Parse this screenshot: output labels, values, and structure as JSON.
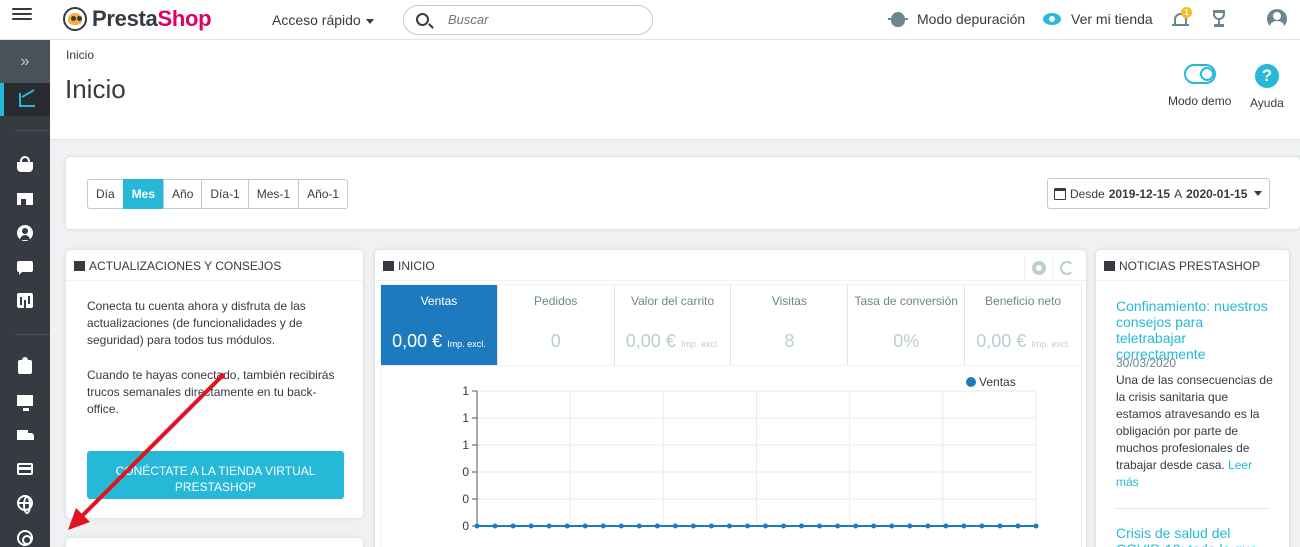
{
  "topbar": {
    "logo_part1": "Presta",
    "logo_part2": "Shop",
    "quick_access": "Acceso rápido",
    "search_placeholder": "Buscar",
    "debug_mode": "Modo depuración",
    "view_store": "Ver mi tienda",
    "notification_count": "1"
  },
  "page": {
    "breadcrumb": "Inicio",
    "title": "Inicio",
    "demo_mode": "Modo demo",
    "help": "Ayuda"
  },
  "filters": {
    "buttons": [
      "Día",
      "Mes",
      "Año",
      "Día-1",
      "Mes-1",
      "Año-1"
    ],
    "active": "Mes",
    "date_from_label": "Desde",
    "date_from": "2019-12-15",
    "date_to_label": "A",
    "date_to": "2020-01-15"
  },
  "updates": {
    "title": "Actualizaciones y consejos",
    "text1": "Conecta tu cuenta ahora y disfruta de las actualizaciones (de funcionalidades y de seguridad) para todos tus módulos.",
    "text2": "Cuando te hayas conectado, también recibirás trucos semanales directamente en tu back-office.",
    "button": "Conéctate a la tienda virtual PrestaShop"
  },
  "dashboard": {
    "title": "Inicio",
    "kpis": [
      {
        "label": "Ventas",
        "value": "0,00 €",
        "suffix": "Imp. excl."
      },
      {
        "label": "Pedidos",
        "value": "0",
        "suffix": ""
      },
      {
        "label": "Valor del carrito",
        "value": "0,00 €",
        "suffix": "Imp. excl."
      },
      {
        "label": "Visitas",
        "value": "8",
        "suffix": ""
      },
      {
        "label": "Tasa de conversión",
        "value": "0%",
        "suffix": ""
      },
      {
        "label": "Beneficio neto",
        "value": "0,00 €",
        "suffix": "Imp. excl."
      }
    ]
  },
  "chart_data": {
    "type": "line",
    "title": "",
    "series": [
      {
        "name": "Ventas",
        "values": [
          0,
          0,
          0,
          0,
          0,
          0,
          0,
          0,
          0,
          0,
          0,
          0,
          0,
          0,
          0,
          0,
          0,
          0,
          0,
          0,
          0,
          0,
          0,
          0,
          0,
          0,
          0,
          0,
          0,
          0,
          0,
          0
        ]
      }
    ],
    "y_ticks": [
      "1",
      "1",
      "1",
      "0",
      "0",
      "0"
    ],
    "series_color": "#1e7abf",
    "legend_position": "top-right"
  },
  "news": {
    "title": "Noticias PrestaShop",
    "item1_title": "Confinamiento: nuestros consejos para teletrabajar correctamente",
    "item1_date": "30/03/2020",
    "item1_body": "Una de las consecuencias de la crisis sanitaria que estamos atravesando es la obligación por parte de muchos profesionales de trabajar desde casa.",
    "item1_more": "Leer más",
    "item2_title": "Crisis de salud del COVID-19: todo lo que los"
  },
  "colors": {
    "accent": "#25b9d7",
    "sidebar": "#363a41",
    "kpi_active": "#1e7abf",
    "annotation_arrow": "#e0141e"
  },
  "sidebar_icons": [
    "expand-icon",
    "dashboard-icon",
    "orders-icon",
    "catalog-icon",
    "customers-icon",
    "messages-icon",
    "stats-icon",
    "modules-icon",
    "design-icon",
    "shipping-icon",
    "payment-icon",
    "international-icon",
    "marketing-icon"
  ]
}
